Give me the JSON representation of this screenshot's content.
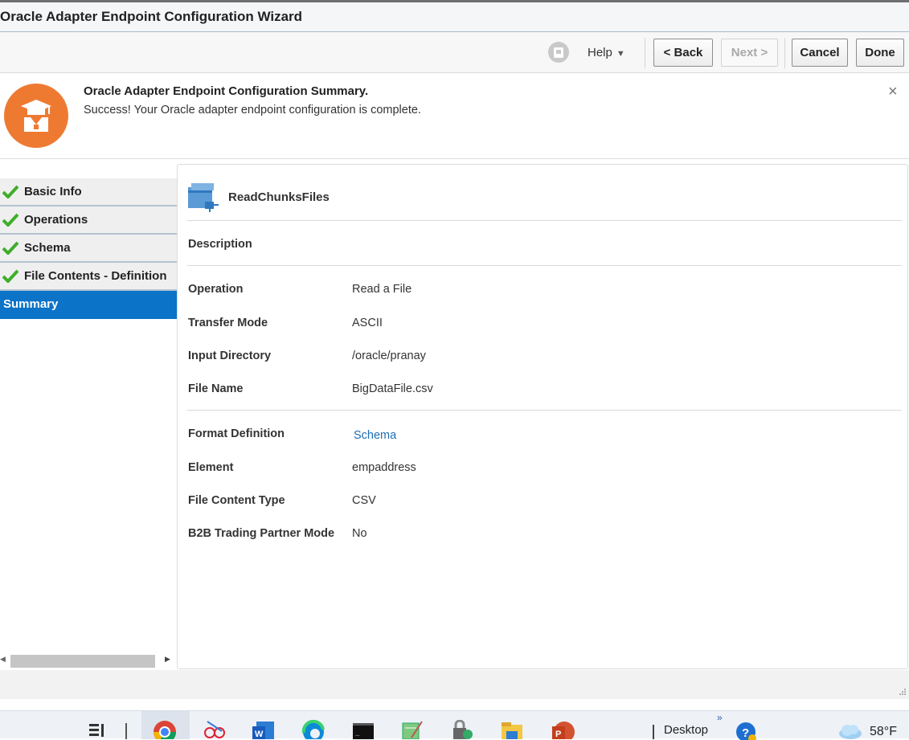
{
  "window": {
    "title": "Oracle Adapter Endpoint Configuration Wizard"
  },
  "toolbar": {
    "help_label": "Help",
    "back_label": "< Back",
    "next_label": "Next >",
    "cancel_label": "Cancel",
    "done_label": "Done",
    "icons": {
      "user": "user-avatar-icon",
      "help_arrow": "caret-down-icon"
    }
  },
  "banner": {
    "title": "Oracle Adapter Endpoint Configuration Summary.",
    "message": "Success! Your Oracle adapter endpoint configuration is complete.",
    "icon": "graduate-icon",
    "close": "×",
    "accent": "#ee7a32"
  },
  "sidebar": {
    "items": [
      {
        "label": "Basic Info",
        "completed": true
      },
      {
        "label": "Operations",
        "completed": true
      },
      {
        "label": "Schema",
        "completed": true
      },
      {
        "label": "File Contents - Definition",
        "completed": true
      },
      {
        "label": "Summary",
        "completed": false,
        "active": true
      }
    ],
    "active_color": "#0b73c8",
    "check_color": "#3fae2a"
  },
  "summary": {
    "endpoint_name": "ReadChunksFiles",
    "description_label": "Description",
    "rows": [
      {
        "label": "Operation",
        "value": "Read a File"
      },
      {
        "label": "Transfer Mode",
        "value": "ASCII"
      },
      {
        "label": "Input Directory",
        "value": "/oracle/pranay"
      },
      {
        "label": "File Name",
        "value": "BigDataFile.csv"
      }
    ],
    "format_label": "Format Definition",
    "format_link": "Schema",
    "rows2": [
      {
        "label": "Element",
        "value": "empaddress"
      },
      {
        "label": "File Content Type",
        "value": "CSV"
      },
      {
        "label": "B2B Trading Partner Mode",
        "value": "No"
      }
    ]
  },
  "taskbar": {
    "desktop_label": "Desktop",
    "temperature": "58°F",
    "icons": [
      "task-view-icon",
      "chrome-icon",
      "snipping-tool-icon",
      "word-icon",
      "edge-icon",
      "terminal-icon",
      "notepad-icon",
      "vpn-lock-icon",
      "file-explorer-icon",
      "powerpoint-icon",
      "help-icon",
      "weather-icon"
    ]
  }
}
